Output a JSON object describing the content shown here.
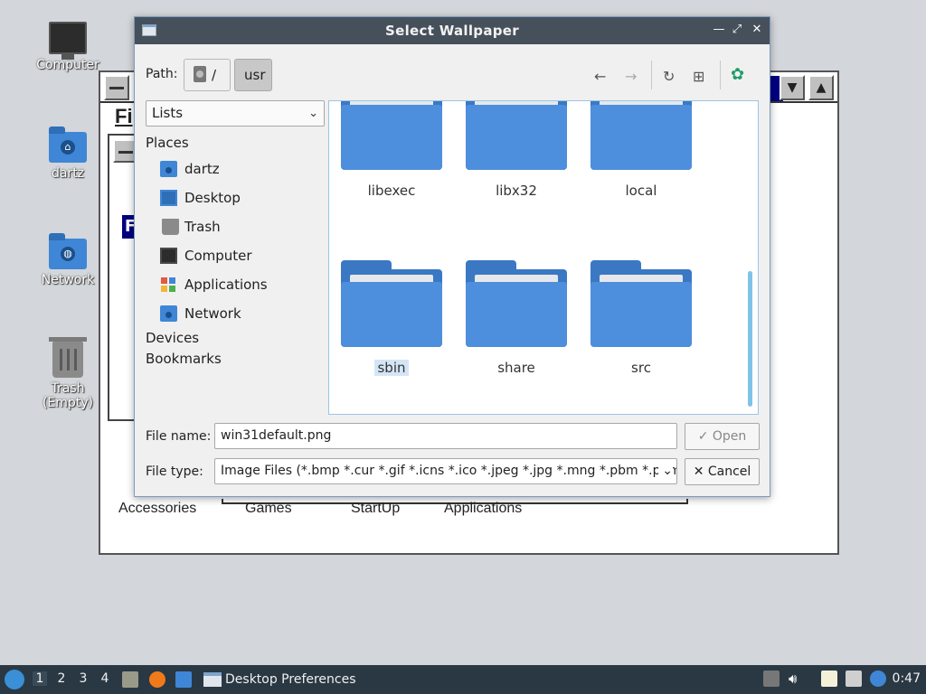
{
  "desktop": {
    "icons": [
      {
        "label": "Computer",
        "icon": "computer-icon"
      },
      {
        "label": "dartz",
        "icon": "home-folder-icon"
      },
      {
        "label": "Network",
        "icon": "network-folder-icon"
      },
      {
        "label": "Trash (Empty)",
        "icon": "trash-icon"
      }
    ]
  },
  "background_window": {
    "menu_letter": "Fi",
    "sub_letter": "F",
    "groups": [
      "Accessories",
      "Games",
      "StartUp",
      "Applications"
    ]
  },
  "dialog": {
    "title": "Select Wallpaper",
    "path_label": "Path:",
    "crumbs": [
      "/",
      "usr"
    ],
    "view_mode": "Lists",
    "places_header": "Places",
    "places": [
      {
        "label": "dartz",
        "icon": "home-folder-icon"
      },
      {
        "label": "Desktop",
        "icon": "desktop-icon"
      },
      {
        "label": "Trash",
        "icon": "trash-icon"
      },
      {
        "label": "Computer",
        "icon": "computer-icon"
      },
      {
        "label": "Applications",
        "icon": "applications-icon"
      },
      {
        "label": "Network",
        "icon": "network-icon"
      }
    ],
    "devices_header": "Devices",
    "bookmarks_header": "Bookmarks",
    "folders": [
      "libexec",
      "libx32",
      "local",
      "sbin",
      "share",
      "src"
    ],
    "selected_folder": "sbin",
    "file_name_label": "File name:",
    "file_name_value": "win31default.png",
    "file_type_label": "File type:",
    "file_type_value": "Image Files (*.bmp *.cur *.gif *.icns *.ico *.jpeg *.jpg *.mng *.pbm *.pgm",
    "open_label": "Open",
    "cancel_label": "Cancel"
  },
  "taskbar": {
    "workspaces": [
      "1",
      "2",
      "3",
      "4"
    ],
    "active_workspace": "1",
    "task_label": "Desktop Preferences",
    "clock": "0:47"
  }
}
